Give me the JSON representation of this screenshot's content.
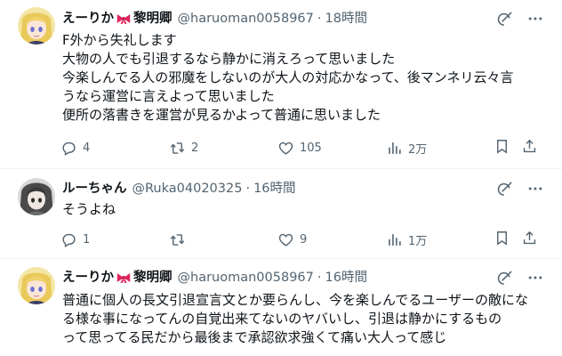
{
  "tweets": [
    {
      "name": "えーりか",
      "suffix": "黎明卿",
      "handle": "@haruoman0058967",
      "time": "18時間",
      "lines": [
        "F外から失礼します",
        "大物の人でも引退するなら静かに消えろって思いました",
        "今楽しんでる人の邪魔をしないのが大人の対応かなって、後マンネリ云々言",
        "うなら運営に言えよって思いました",
        "便所の落書きを運営が見るかよって普通に思いました"
      ],
      "replies": "4",
      "retweets": "2",
      "likes": "105",
      "views": "2万"
    },
    {
      "name": "ルーちゃん",
      "suffix": "",
      "handle": "@Ruka04020325",
      "time": "16時間",
      "lines": [
        "そうよね"
      ],
      "replies": "1",
      "retweets": "",
      "likes": "9",
      "views": "1万"
    },
    {
      "name": "えーりか",
      "suffix": "黎明卿",
      "handle": "@haruoman0058967",
      "time": "16時間",
      "lines": [
        "普通に個人の長文引退宣言文とか要らんし、今を楽しんでるユーザーの敵にな",
        "る様な事になってんの自覚出来てないのヤバいし、引退は静かにするもの",
        "って思ってる民だから最後まで承認欲求強くて痛い大人って感じ"
      ]
    }
  ],
  "colors": {
    "text": "#0f1419",
    "muted": "#536471",
    "divider": "#eff3f4",
    "bow": "#e0245e"
  },
  "icons": [
    "grok-icon",
    "more-icon",
    "reply-icon",
    "retweet-icon",
    "like-icon",
    "views-icon",
    "bookmark-icon",
    "share-icon"
  ]
}
